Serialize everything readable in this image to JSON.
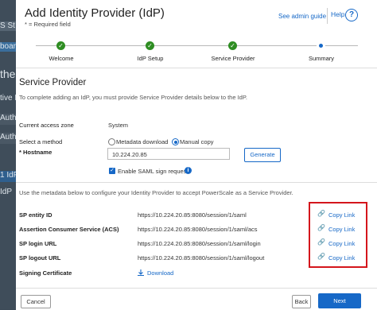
{
  "background": {
    "strips": [
      "S St",
      "board",
      "the",
      "tive I",
      "Auth",
      "Auth",
      "1 IdP",
      "IdP"
    ]
  },
  "header": {
    "title": "Add Identity Provider (IdP)",
    "required_note": "* = Required field",
    "admin_guide": "See admin guide",
    "help": "Help",
    "help_icon": "?"
  },
  "steps": [
    {
      "label": "Welcome",
      "state": "done"
    },
    {
      "label": "IdP Setup",
      "state": "done"
    },
    {
      "label": "Service Provider",
      "state": "done"
    },
    {
      "label": "Summary",
      "state": "current"
    }
  ],
  "section": {
    "title": "Service Provider",
    "intro": "To complete adding an IdP, you must provide Service Provider details below to the IdP."
  },
  "form": {
    "zone_label": "Current access zone",
    "zone_value": "System",
    "method_label": "Select a method",
    "method_options": [
      "Metadata download",
      "Manual copy"
    ],
    "method_selected": "Manual copy",
    "hostname_label": "* Hostname",
    "hostname_value": "10.224.20.85",
    "generate_label": "Generate",
    "saml_sign_label": "Enable SAML sign request",
    "saml_sign_checked": true
  },
  "metadata_intro": "Use the metadata below to configure your Identity Provider to accept PowerScale as a Service Provider.",
  "sp_rows": [
    {
      "label": "SP entity ID",
      "value": "https://10.224.20.85:8080/session/1/saml",
      "link": "Copy Link"
    },
    {
      "label": "Assertion Consumer Service (ACS)",
      "value": "https://10.224.20.85:8080/session/1/saml/acs",
      "link": "Copy Link"
    },
    {
      "label": "SP login URL",
      "value": "https://10.224.20.85:8080/session/1/saml/login",
      "link": "Copy Link"
    },
    {
      "label": "SP logout URL",
      "value": "https://10.224.20.85:8080/session/1/saml/logout",
      "link": "Copy Link"
    }
  ],
  "signing": {
    "label": "Signing Certificate",
    "download": "Download"
  },
  "footer": {
    "cancel": "Cancel",
    "back": "Back",
    "next": "Next"
  },
  "colors": {
    "accent": "#1668c7",
    "done": "#2e8d22",
    "highlight": "#d4161c"
  }
}
